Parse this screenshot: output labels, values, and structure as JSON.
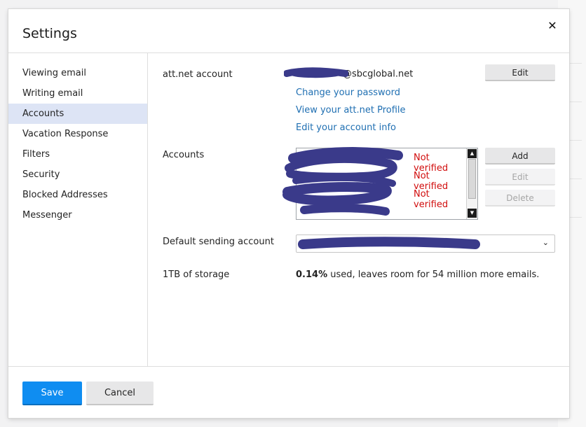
{
  "dialog": {
    "title": "Settings"
  },
  "sidebar": {
    "items": [
      {
        "label": "Viewing email"
      },
      {
        "label": "Writing email"
      },
      {
        "label": "Accounts",
        "active": true
      },
      {
        "label": "Vacation Response"
      },
      {
        "label": "Filters"
      },
      {
        "label": "Security"
      },
      {
        "label": "Blocked Addresses"
      },
      {
        "label": "Messenger"
      }
    ]
  },
  "account": {
    "label": "att.net account",
    "email_suffix": "@sbcglobal.net",
    "edit_label": "Edit",
    "links": [
      "Change your password",
      "View your att.net Profile",
      "Edit your account info"
    ]
  },
  "accounts": {
    "label": "Accounts",
    "rows": [
      {
        "status": "Not verified"
      },
      {
        "status": "Not verified"
      },
      {
        "status": "Not verified"
      }
    ],
    "add_label": "Add",
    "edit_label": "Edit",
    "delete_label": "Delete"
  },
  "default_sending": {
    "label": "Default sending account"
  },
  "storage": {
    "label": "1TB of storage",
    "percent": "0.14%",
    "text": " used, leaves room for 54 million more emails."
  },
  "footer": {
    "save_label": "Save",
    "cancel_label": "Cancel"
  },
  "colors": {
    "accent_blue": "#0f8df1",
    "link_blue": "#1f6fb2",
    "status_red": "#d10d0d",
    "active_nav": "#dde4f5",
    "redaction": "#3a3a8a"
  },
  "icons": {
    "close": "close-icon",
    "dropdown": "chevron-down-icon"
  }
}
